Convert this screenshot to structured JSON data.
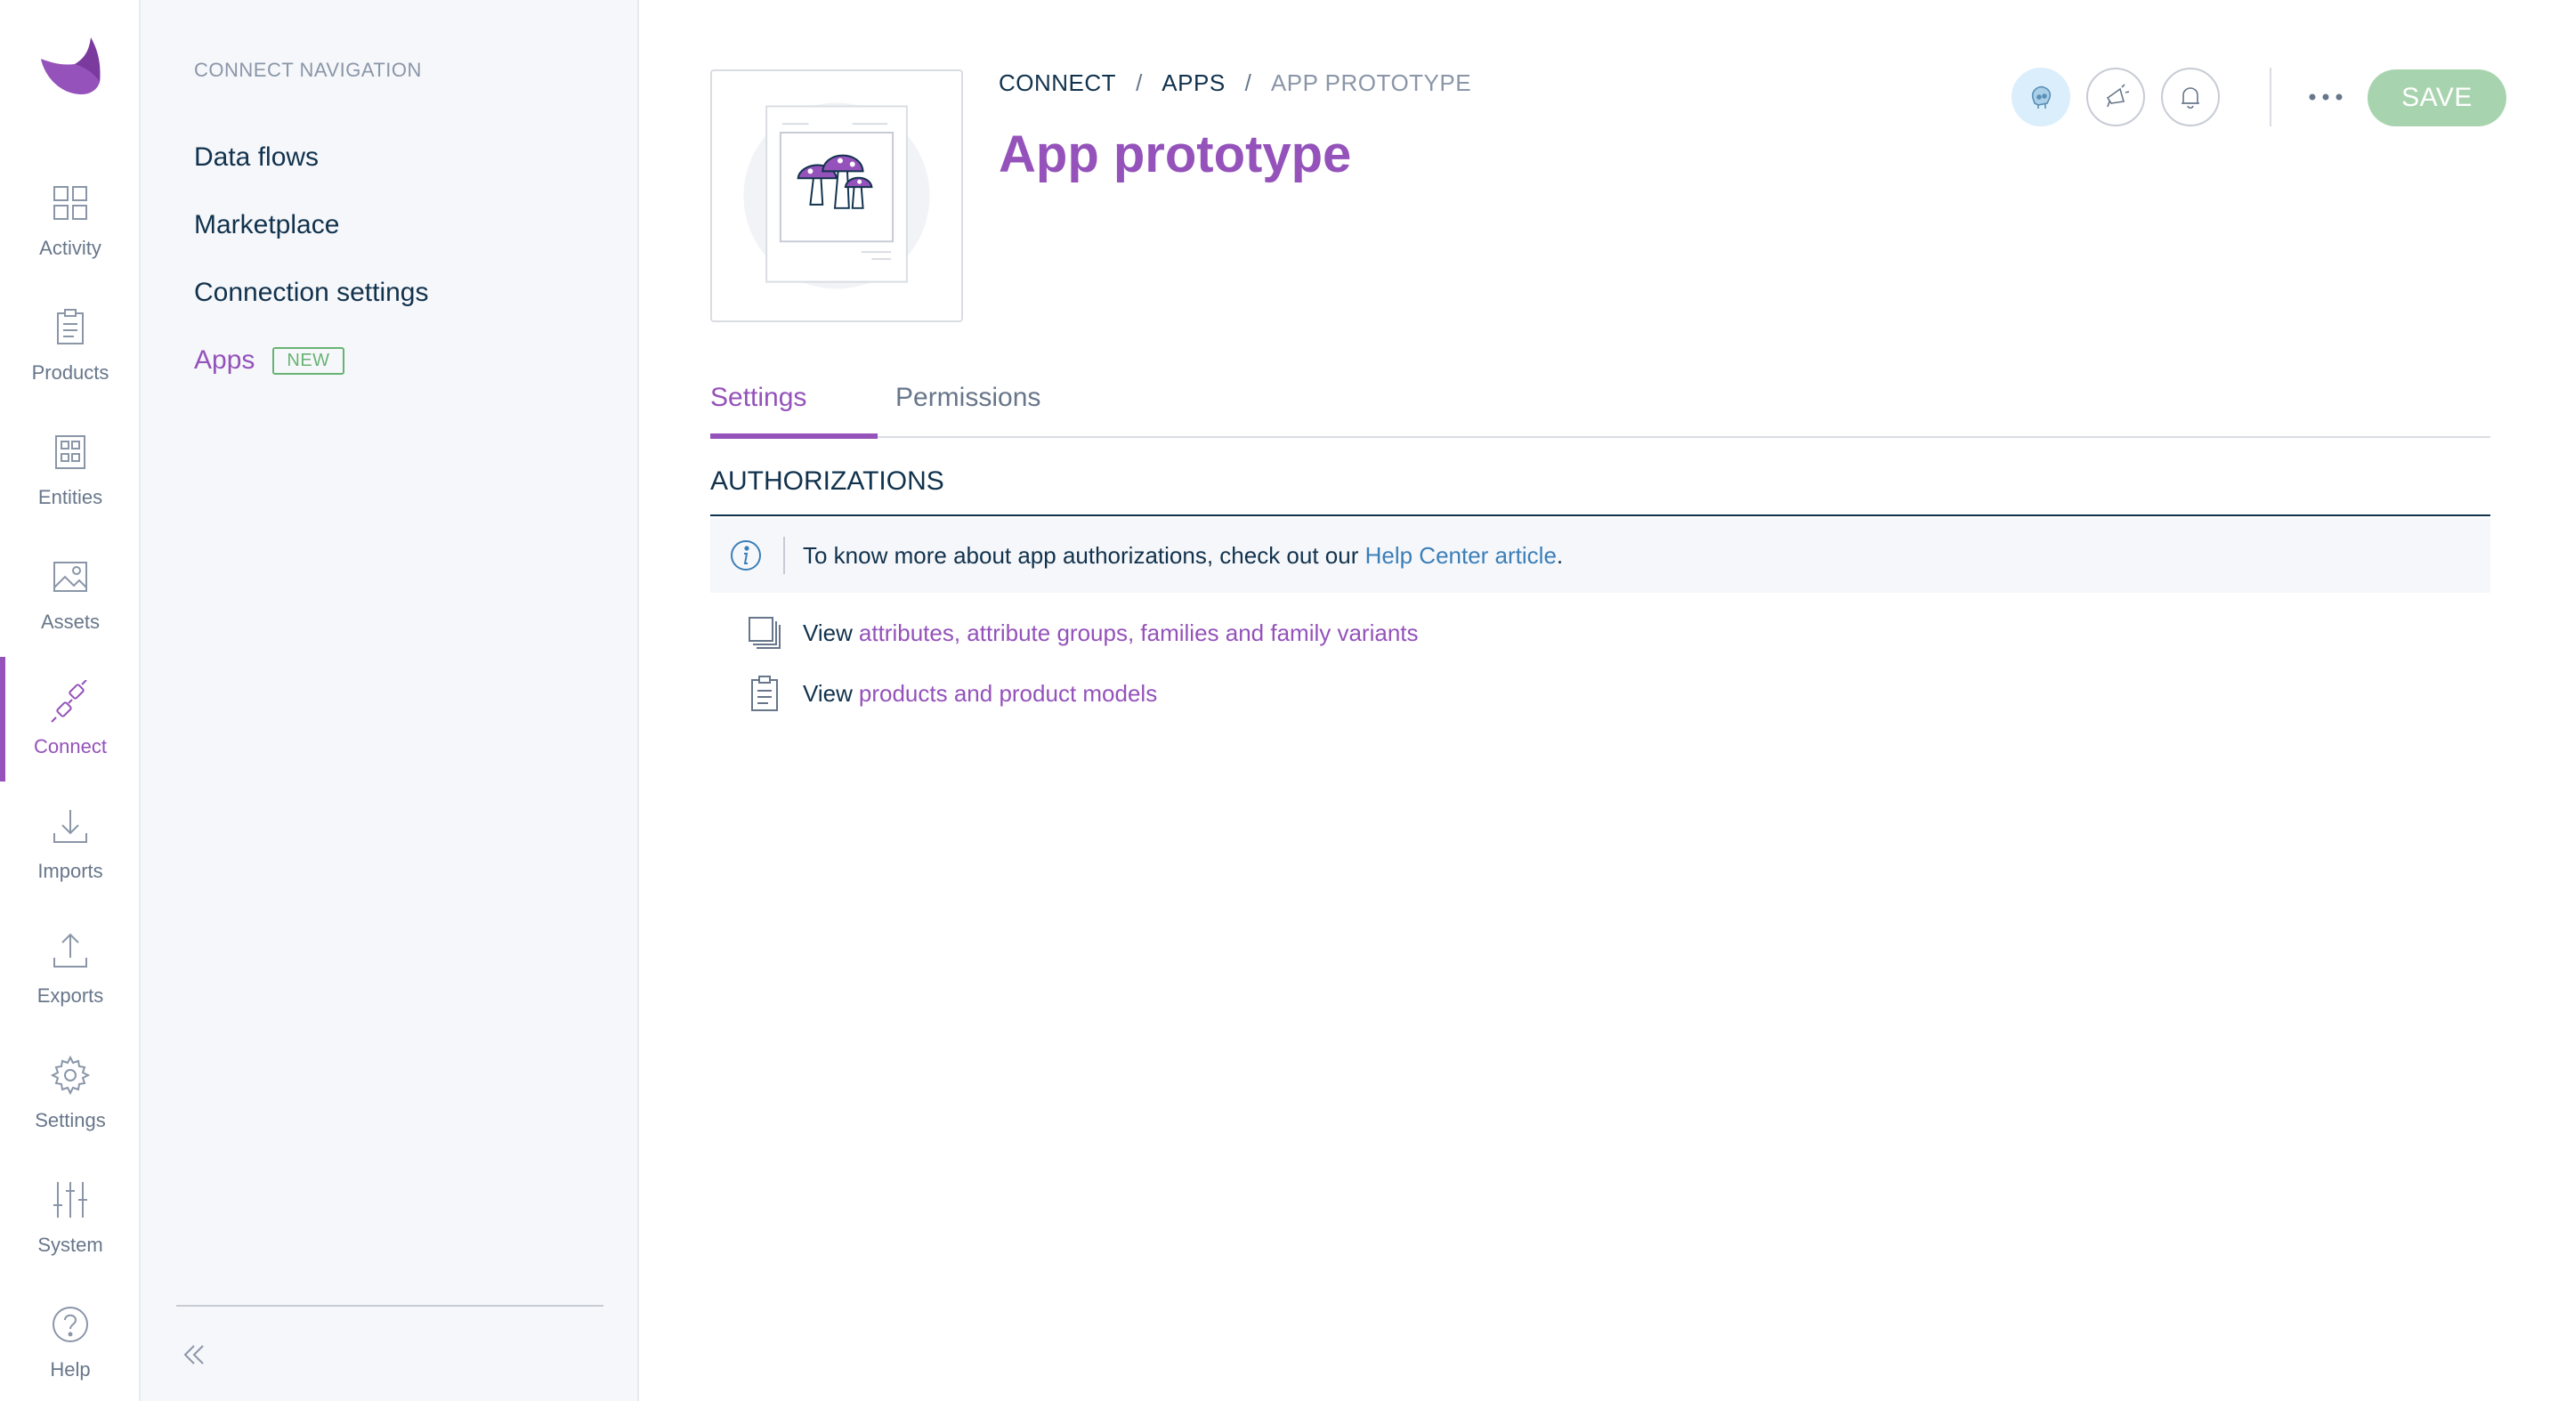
{
  "rail": {
    "items": [
      {
        "label": "Activity",
        "icon": "activity-icon"
      },
      {
        "label": "Products",
        "icon": "products-icon"
      },
      {
        "label": "Entities",
        "icon": "entities-icon"
      },
      {
        "label": "Assets",
        "icon": "assets-icon"
      },
      {
        "label": "Connect",
        "icon": "connect-icon",
        "active": true
      },
      {
        "label": "Imports",
        "icon": "imports-icon"
      },
      {
        "label": "Exports",
        "icon": "exports-icon"
      },
      {
        "label": "Settings",
        "icon": "settings-icon"
      },
      {
        "label": "System",
        "icon": "system-icon"
      },
      {
        "label": "Help",
        "icon": "help-icon"
      }
    ]
  },
  "subnav": {
    "section_title": "CONNECT NAVIGATION",
    "items": [
      {
        "label": "Data flows"
      },
      {
        "label": "Marketplace"
      },
      {
        "label": "Connection settings"
      },
      {
        "label": "Apps",
        "badge": "NEW",
        "active": true
      }
    ]
  },
  "header": {
    "breadcrumb": [
      "CONNECT",
      "APPS",
      "APP PROTOTYPE"
    ],
    "separator": "/",
    "title": "App prototype",
    "save_label": "SAVE"
  },
  "tabs": [
    {
      "label": "Settings",
      "active": true
    },
    {
      "label": "Permissions",
      "active": false
    }
  ],
  "authorizations": {
    "title": "AUTHORIZATIONS",
    "helper_text": "To know more about app authorizations, check out our ",
    "helper_link": "Help Center article",
    "helper_suffix": ".",
    "items": [
      {
        "verb": "View",
        "object": "attributes, attribute groups, families and family variants",
        "icon": "copy-icon"
      },
      {
        "verb": "View",
        "object": "products and product models",
        "icon": "clipboard-icon"
      }
    ]
  },
  "colors": {
    "accent": "#9452ba",
    "save_disabled": "#a7d4ae",
    "link_blue": "#3b7fb8",
    "badge_green": "#67b373"
  }
}
